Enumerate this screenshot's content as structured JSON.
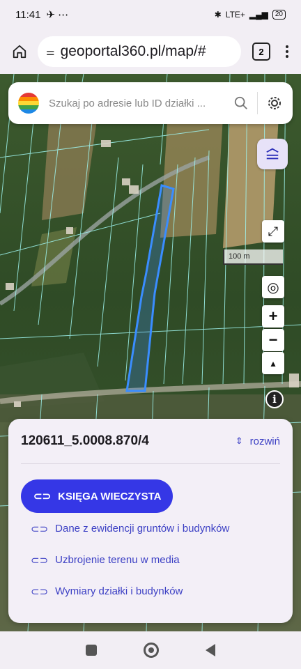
{
  "status": {
    "time": "11:41",
    "left_icons": "✈ ⋯",
    "network": "LTE+",
    "battery": "20"
  },
  "browser": {
    "url": "geoportal360.pl/map/#",
    "tab_count": "2"
  },
  "search": {
    "placeholder": "Szukaj po adresie lub ID działki ..."
  },
  "map": {
    "scale_label": "100 m",
    "highlight_color": "#3a8dff"
  },
  "panel": {
    "parcel_id": "120611_5.0008.870/4",
    "expand_label": "rozwiń",
    "primary_button": "KSIĘGA WIECZYSTA",
    "links": [
      "Dane z ewidencji gruntów i budynków",
      "Uzbrojenie terenu w media",
      "Wymiary działki i budynków"
    ]
  },
  "colors": {
    "accent": "#3537e6",
    "link": "#3b3fc4",
    "panel_bg": "#f3eff7"
  }
}
